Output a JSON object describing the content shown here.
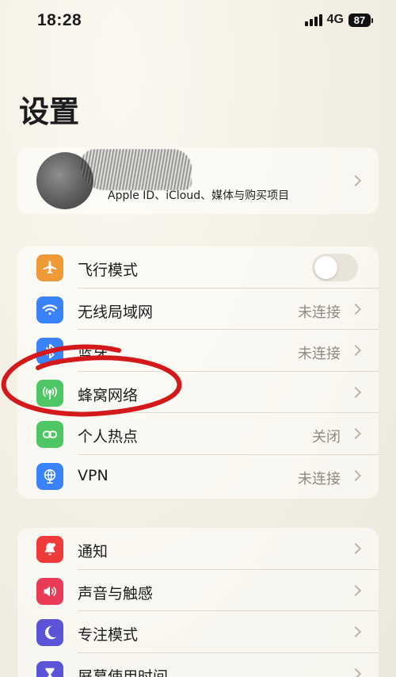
{
  "status_bar": {
    "time": "18:28",
    "network": "4G",
    "battery": "87"
  },
  "page": {
    "title": "设置"
  },
  "profile": {
    "subtitle": "Apple ID、iCloud、媒体与购买项目"
  },
  "network_group": [
    {
      "label": "飞行模式",
      "value": "",
      "icon": "airplane-icon",
      "color": "#f09a37",
      "toggle": true,
      "toggle_on": false
    },
    {
      "label": "无线局域网",
      "value": "未连接",
      "icon": "wifi-icon",
      "color": "#3a82f7"
    },
    {
      "label": "蓝牙",
      "value": "未连接",
      "icon": "bluetooth-icon",
      "color": "#3a82f7"
    },
    {
      "label": "蜂窝网络",
      "value": "",
      "icon": "cellular-icon",
      "color": "#4cc764"
    },
    {
      "label": "个人热点",
      "value": "关闭",
      "icon": "hotspot-icon",
      "color": "#4cc764"
    },
    {
      "label": "VPN",
      "value": "未连接",
      "icon": "vpn-icon",
      "color": "#3a82f7"
    }
  ],
  "general_group": [
    {
      "label": "通知",
      "icon": "notification-icon",
      "color": "#ee3b3a"
    },
    {
      "label": "声音与触感",
      "icon": "sound-icon",
      "color": "#ea3a55"
    },
    {
      "label": "专注模式",
      "icon": "moon-icon",
      "color": "#5b54d6"
    },
    {
      "label": "屏幕使用时间",
      "icon": "hourglass-icon",
      "color": "#5b54d6"
    }
  ],
  "colors": {
    "background": "#f3efe4",
    "annotation_red": "#d4191b",
    "secondary_text": "#8e8b85"
  }
}
